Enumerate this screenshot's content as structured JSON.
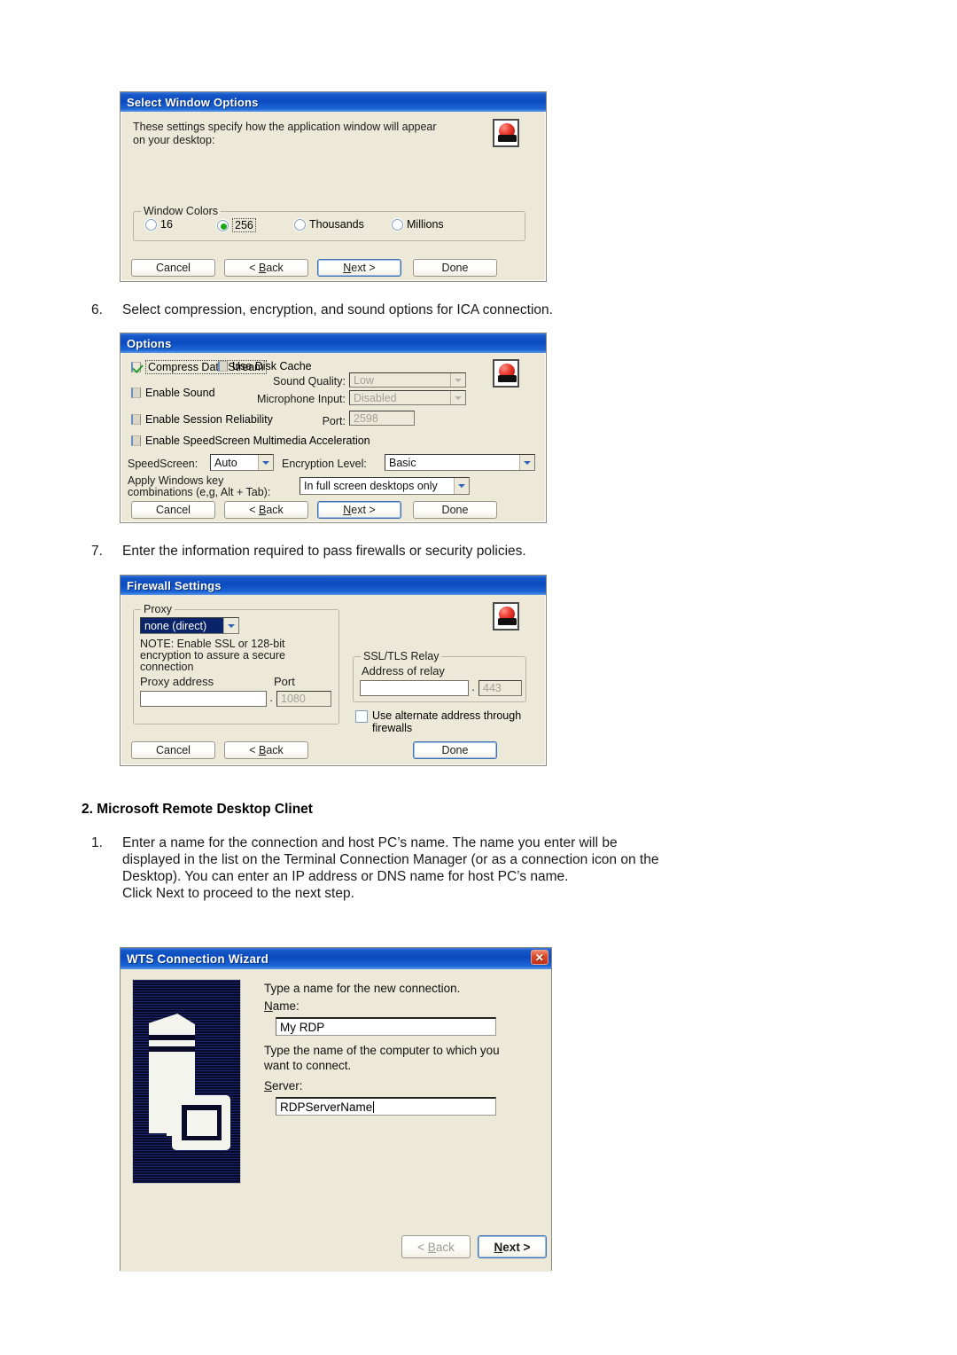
{
  "document": {
    "steps": [
      {
        "num": "6.",
        "text": "Select compression, encryption, and sound options for ICA connection."
      },
      {
        "num": "7.",
        "text": "Enter the information required to pass firewalls or security policies."
      }
    ],
    "section_heading": "2. Microsoft Remote Desktop Clinet",
    "step1": {
      "num": "1.",
      "line1": "Enter a name for the connection and host PC’s name. The name you enter will be",
      "line2": "displayed in the list on the Terminal Connection Manager (or as a connection icon on the",
      "line3": "Desktop). You can enter an IP address or DNS name for host PC’s name.",
      "line4": "Click Next to proceed to the next step."
    }
  },
  "select_window_options": {
    "title": "Select Window Options",
    "intro_line1": "These settings specify how the application window will appear",
    "intro_line2": "on your desktop:",
    "group_title": "Window Colors",
    "options": [
      {
        "label": "16",
        "selected": false,
        "focused": false
      },
      {
        "label": "256",
        "selected": true,
        "focused": true
      },
      {
        "label": "Thousands",
        "selected": false,
        "focused": false
      },
      {
        "label": "Millions",
        "selected": false,
        "focused": false
      }
    ],
    "buttons": {
      "cancel": "Cancel",
      "back_pre": "< ",
      "back_key": "B",
      "back_post": "ack",
      "next_key": "N",
      "next_post": "ext >",
      "done": "Done"
    }
  },
  "options_dialog": {
    "title": "Options",
    "checkboxes": {
      "compress": {
        "label": "Compress Data Stream",
        "checked": true,
        "focused": true
      },
      "disk_cache": {
        "label": "Use Disk Cache",
        "checked": false
      },
      "enable_sound": {
        "label": "Enable Sound",
        "checked": false
      },
      "session_reliability": {
        "label": "Enable Session Reliability",
        "checked": false
      },
      "speedscreen_mm": {
        "label": "Enable SpeedScreen Multimedia Acceleration",
        "checked": false
      }
    },
    "labels": {
      "sound_quality": "Sound Quality:",
      "microphone_input": "Microphone Input:",
      "port": "Port:",
      "speedscreen": "SpeedScreen:",
      "encryption_level": "Encryption Level:",
      "winkey_line1": "Apply Windows key",
      "winkey_line2": "combinations (e,g, Alt + Tab):"
    },
    "values": {
      "sound_quality": "Low",
      "microphone_input": "Disabled",
      "port": "2598",
      "speedscreen": "Auto",
      "encryption_level": "Basic",
      "winkey": "In full screen desktops only"
    },
    "buttons": {
      "cancel": "Cancel",
      "back_pre": "< ",
      "back_key": "B",
      "back_post": "ack",
      "next_key": "N",
      "next_post": "ext >",
      "done": "Done"
    }
  },
  "firewall_settings": {
    "title": "Firewall Settings",
    "proxy_group": "Proxy",
    "proxy_value": "none (direct)",
    "note_line1": "NOTE: Enable SSL or 128-bit",
    "note_line2": "encryption to assure a secure",
    "note_line3": "connection",
    "proxy_address_label": "Proxy address",
    "proxy_address_value": "",
    "port_label": "Port",
    "port_value": "1080",
    "dot_sep": "·",
    "relay_group": "SSL/TLS Relay",
    "relay_address_label": "Address of relay",
    "relay_address_value": "",
    "relay_port_value": "443",
    "alt_addr_line1": "Use alternate address through",
    "alt_addr_line2": "firewalls",
    "alt_addr_checked": false,
    "buttons": {
      "cancel": "Cancel",
      "back_pre": "< ",
      "back_key": "B",
      "back_post": "ack",
      "done": "Done"
    }
  },
  "wts_wizard": {
    "title": "WTS Connection Wizard",
    "close_glyph": "✕",
    "prompt_name": "Type a name for the new connection.",
    "name_key": "N",
    "name_post": "ame:",
    "name_value": "My RDP",
    "prompt_server_line1": "Type the name of the computer to which you",
    "prompt_server_line2": "want to connect.",
    "server_key": "S",
    "server_post": "erver:",
    "server_value": "RDPServerName",
    "buttons": {
      "back_pre": "< ",
      "back_key": "B",
      "back_post": "ack",
      "next_key": "N",
      "next_post": "ext >"
    }
  },
  "colors": {
    "dialog_face": "#ece9d8",
    "title_blue": "#0a4ac0",
    "selection_blue": "#0a246a",
    "accent_red": "#e8372b",
    "check_green": "#1f9c2c",
    "art_navy": "#090a28"
  }
}
